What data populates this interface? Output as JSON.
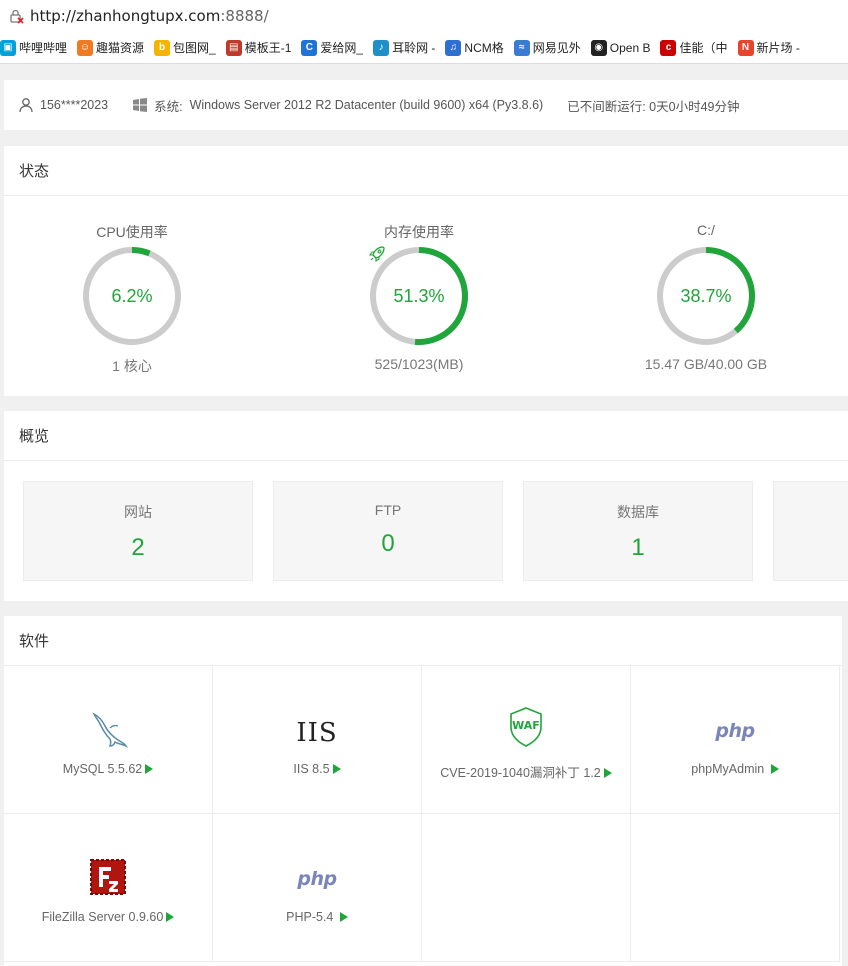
{
  "browser": {
    "url_main": "http://zhanhongtupx.com",
    "url_port": ":8888/",
    "bookmarks": [
      {
        "label": "哔哩哔哩",
        "icon": "bilibili-icon",
        "color": "#00a1d6"
      },
      {
        "label": "趣猫资源",
        "icon": "cat-icon",
        "color": "#f07a21"
      },
      {
        "label": "包图网_",
        "icon": "baotu-icon",
        "color": "#f5b400"
      },
      {
        "label": "模板王-1",
        "icon": "template-icon",
        "color": "#c0392b"
      },
      {
        "label": "爱给网_",
        "icon": "aigei-icon",
        "color": "#1e73d8"
      },
      {
        "label": "耳聆网 -",
        "icon": "ear-icon",
        "color": "#1e90c8"
      },
      {
        "label": "NCM格",
        "icon": "music-note-icon",
        "color": "#2f6fd0"
      },
      {
        "label": "网易见外",
        "icon": "wave-icon",
        "color": "#3a7bd5"
      },
      {
        "label": "Open B",
        "icon": "obs-icon",
        "color": "#222222"
      },
      {
        "label": "佳能（中",
        "icon": "canon-icon",
        "color": "#cc0000"
      },
      {
        "label": "新片场 -",
        "icon": "new-icon",
        "color": "#e8452c"
      }
    ]
  },
  "info": {
    "user": "156****2023",
    "system_label": "系统:",
    "system_value": "Windows Server 2012 R2 Datacenter (build 9600) x64 (Py3.8.6)",
    "uptime": "已不间断运行: 0天0小时49分钟"
  },
  "status": {
    "title": "状态",
    "gauges": [
      {
        "label": "CPU使用率",
        "percent_text": "6.2%",
        "percent": 6.2,
        "sub": "1 核心"
      },
      {
        "label": "内存使用率",
        "percent_text": "51.3%",
        "percent": 51.3,
        "sub": "525/1023(MB)"
      },
      {
        "label": "C:/",
        "percent_text": "38.7%",
        "percent": 38.7,
        "sub": "15.47 GB/40.00 GB"
      }
    ]
  },
  "overview": {
    "title": "概览",
    "cards": [
      {
        "name": "网站",
        "value": "2"
      },
      {
        "name": "FTP",
        "value": "0"
      },
      {
        "name": "数据库",
        "value": "1"
      }
    ]
  },
  "software": {
    "title": "软件",
    "items": [
      {
        "name": "MySQL 5.5.62",
        "logo": "mysql-dolphin-icon"
      },
      {
        "name": "IIS 8.5",
        "logo": "iis-logo",
        "logo_text": "IIS"
      },
      {
        "name": "CVE-2019-1040漏洞补丁 1.2",
        "logo": "waf-shield-icon",
        "logo_text": "WAF"
      },
      {
        "name": "phpMyAdmin",
        "logo": "php-logo",
        "logo_text": "php"
      },
      {
        "name": "FileZilla Server 0.9.60",
        "logo": "filezilla-icon"
      },
      {
        "name": "PHP-5.4",
        "logo": "php-logo",
        "logo_text": "php"
      }
    ]
  },
  "colors": {
    "accent": "#20a53a",
    "track": "#cccccc"
  }
}
